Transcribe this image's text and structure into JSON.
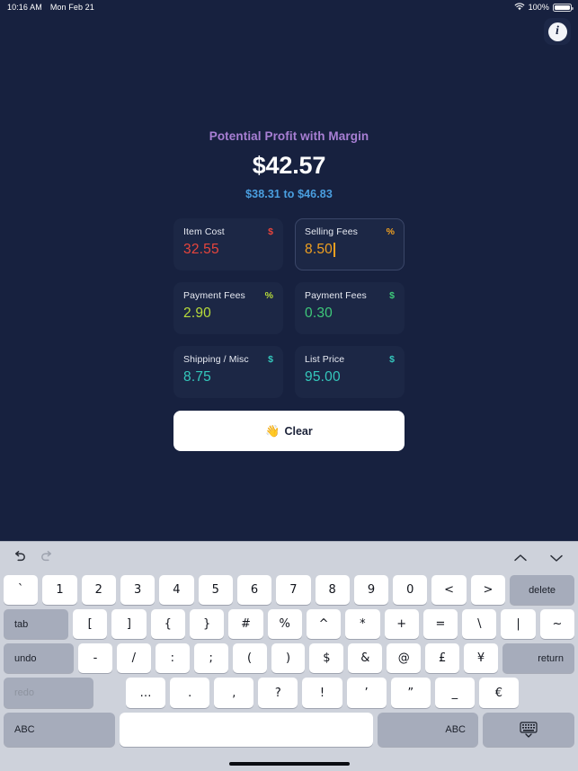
{
  "status_bar": {
    "time": "10:16 AM",
    "date": "Mon Feb 21",
    "wifi_icon": "wifi-icon",
    "battery_percent": "100%",
    "battery_icon": "battery-full-icon"
  },
  "header": {
    "info_icon": "info-icon",
    "title": "Potential Profit with Margin",
    "amount": "$42.57",
    "range": "$38.31 to $46.83",
    "title_color": "#a87fd4",
    "amount_color": "#ffffff",
    "range_color": "#4a9fe0"
  },
  "fields": [
    {
      "label": "Item Cost",
      "unit": "$",
      "value": "32.55",
      "color": "#e8453c",
      "focused": false
    },
    {
      "label": "Selling Fees",
      "unit": "%",
      "value": "8.50",
      "color": "#f0a020",
      "focused": true
    },
    {
      "label": "Payment Fees",
      "unit": "%",
      "value": "2.90",
      "color": "#b8dc3a",
      "focused": false
    },
    {
      "label": "Payment Fees",
      "unit": "$",
      "value": "0.30",
      "color": "#3ec87a",
      "focused": false
    },
    {
      "label": "Shipping / Misc",
      "unit": "$",
      "value": "8.75",
      "color": "#34c8bc",
      "focused": false
    },
    {
      "label": "List Price",
      "unit": "$",
      "value": "95.00",
      "color": "#34c8bc",
      "focused": false
    }
  ],
  "clear_button": {
    "emoji": "👋",
    "label": "Clear"
  },
  "keyboard": {
    "toolbar": {
      "undo_icon": "undo-arrow-icon",
      "redo_icon": "redo-arrow-icon",
      "prev_icon": "chevron-up-icon",
      "next_icon": "chevron-down-icon"
    },
    "row1": [
      "`",
      "1",
      "2",
      "3",
      "4",
      "5",
      "6",
      "7",
      "8",
      "9",
      "0",
      "<",
      ">"
    ],
    "row1_delete": "delete",
    "row2_tab": "tab",
    "row2": [
      "[",
      "]",
      "{",
      "}",
      "#",
      "%",
      "^",
      "*",
      "+",
      "=",
      "\\",
      "|",
      "~"
    ],
    "row3_undo": "undo",
    "row3": [
      "-",
      "/",
      ":",
      ";",
      "(",
      ")",
      "$",
      "&",
      "@",
      "£",
      "¥"
    ],
    "row3_return": "return",
    "row4_redo": "redo",
    "row4": [
      "…",
      ".",
      ",",
      "?",
      "!",
      "’",
      "”",
      "_",
      "€"
    ],
    "row5_abc_left": "ABC",
    "row5_space": "",
    "row5_abc_right": "ABC",
    "row5_dismiss_icon": "keyboard-dismiss-icon"
  }
}
